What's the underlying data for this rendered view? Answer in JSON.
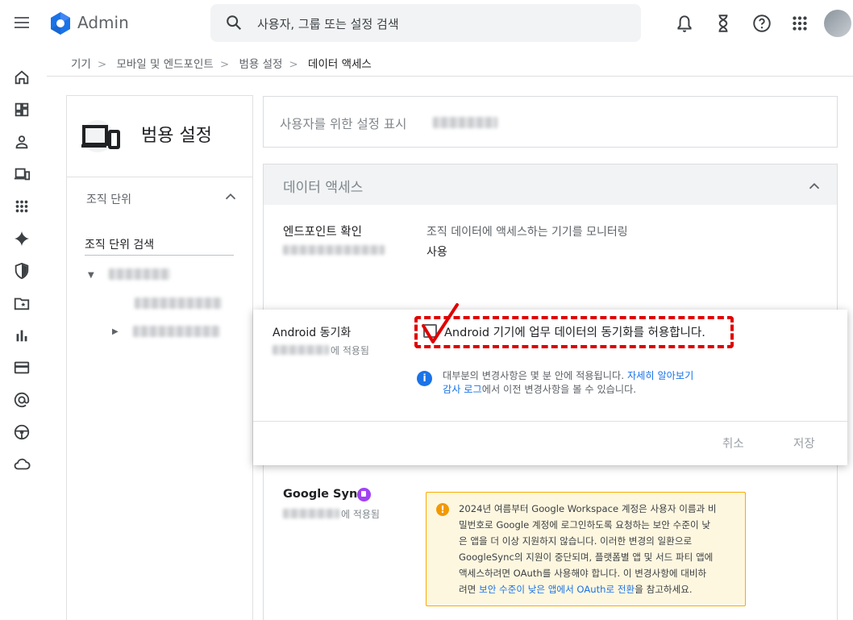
{
  "app": {
    "name": "Admin"
  },
  "search": {
    "placeholder": "사용자, 그룹 또는 설정 검색"
  },
  "breadcrumb": [
    "기기",
    "모바일 및 엔드포인트",
    "범용 설정",
    "데이터 액세스"
  ],
  "left_panel": {
    "title": "범용 설정",
    "ou_label": "조직 단위",
    "ou_search": "조직 단위 검색"
  },
  "display_for_users": "사용자를 위한 설정 표시",
  "section": {
    "title": "데이터 액세스",
    "endpoint": {
      "title": "엔드포인트 확인",
      "description": "조직 데이터에 액세스하는 기기를 모니터링",
      "value": "사용"
    },
    "google_sync": {
      "title": "Google Sync",
      "applied": "에 적용됨",
      "warning": [
        "2024년 여름부터 Google Workspace 계정은 사용자 이름과 비",
        "밀번호로 Google 계정에 로그인하도록 요청하는 보안 수준이 낮",
        "은 앱을 더 이상 지원하지 않습니다. 이러한 변경의 일환으로",
        "GoogleSync의 지원이 중단되며, 플랫폼별 앱 및 서드 파티 앱에",
        "액세스하려면 OAuth를 사용해야 합니다. 이 변경사항에 대비하"
      ],
      "warning_last_prefix": "려면 ",
      "warning_link": "보안 수준이 낮은 앱에서 OAuth로 전환",
      "warning_last_suffix": "을 참고하세요."
    }
  },
  "popup": {
    "title": "Android 동기화",
    "applied": "에 적용됨",
    "checkbox_label": "Android 기기에 업무 데이터의 동기화를 허용합니다.",
    "checked": false,
    "info_line1": "대부분의 변경사항은 몇 분 안에 적용됩니다. ",
    "info_link1": "자세히 알아보기",
    "info_link2": "감사 로그",
    "info_line2": "에서 이전 변경사항을 볼 수 있습니다.",
    "cancel": "취소",
    "save": "저장"
  },
  "colors": {
    "accent": "#1a73e8",
    "annotation": "#e00000",
    "warning_bg": "#fef7e0"
  }
}
